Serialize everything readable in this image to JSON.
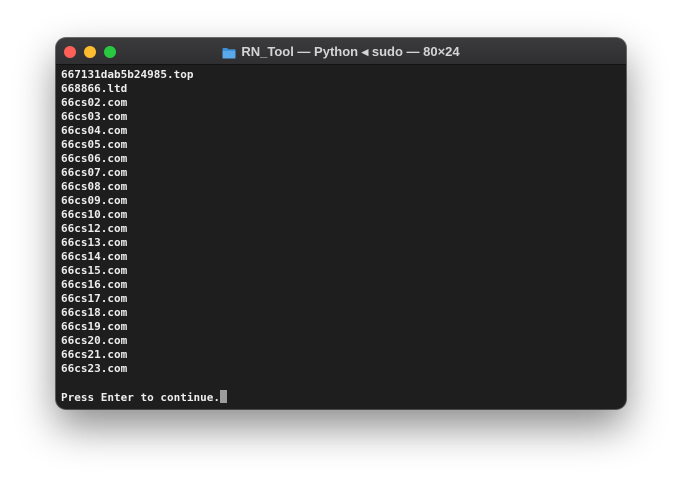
{
  "window": {
    "title": "RN_Tool — Python ◂ sudo — 80×24",
    "controls": {
      "close_color": "#fe5f57",
      "minimize_color": "#febc2e",
      "zoom_color": "#28c840"
    },
    "title_icon": "folder-icon"
  },
  "terminal": {
    "lines": [
      "667131dab5b24985.top",
      "668866.ltd",
      "66cs02.com",
      "66cs03.com",
      "66cs04.com",
      "66cs05.com",
      "66cs06.com",
      "66cs07.com",
      "66cs08.com",
      "66cs09.com",
      "66cs10.com",
      "66cs12.com",
      "66cs13.com",
      "66cs14.com",
      "66cs15.com",
      "66cs16.com",
      "66cs17.com",
      "66cs18.com",
      "66cs19.com",
      "66cs20.com",
      "66cs21.com",
      "66cs23.com"
    ],
    "prompt": "Press Enter to continue.",
    "text_color": "#ededed",
    "background": "#1e1e1e"
  }
}
